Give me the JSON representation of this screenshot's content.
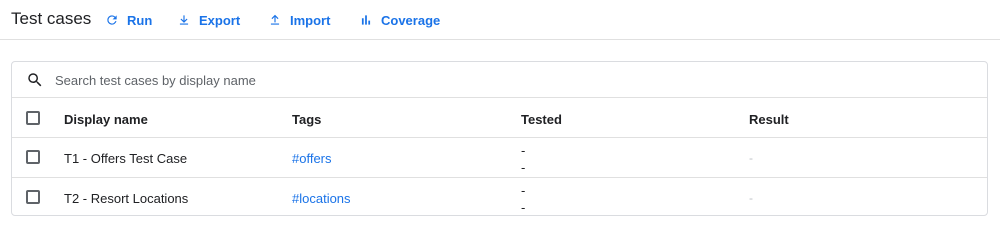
{
  "toolbar": {
    "title": "Test cases",
    "run_label": "Run",
    "export_label": "Export",
    "import_label": "Import",
    "coverage_label": "Coverage"
  },
  "search": {
    "placeholder": "Search test cases by display name",
    "value": ""
  },
  "table": {
    "columns": [
      "Display name",
      "Tags",
      "Tested",
      "Result"
    ],
    "rows": [
      {
        "name": "T1 - Offers Test Case",
        "tag": "#offers",
        "tested": [
          "-",
          "-"
        ],
        "result": "-"
      },
      {
        "name": "T2 - Resort Locations",
        "tag": "#locations",
        "tested": [
          "-",
          "-"
        ],
        "result": "-"
      }
    ]
  },
  "colors": {
    "accent": "#1a73e8",
    "text": "#202124",
    "muted": "#5f6368",
    "border": "#dadce0"
  },
  "icons": [
    "refresh-icon",
    "download-icon",
    "upload-icon",
    "bar-chart-icon",
    "search-icon"
  ]
}
